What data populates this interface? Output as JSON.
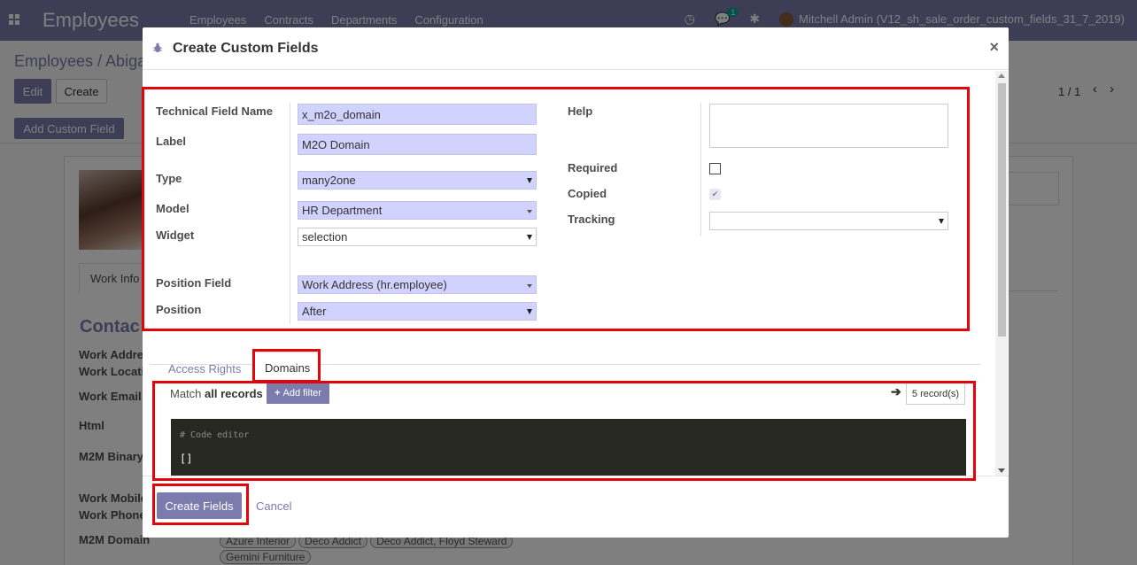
{
  "app": {
    "title": "Employees",
    "menu": [
      "Employees",
      "Contracts",
      "Departments",
      "Configuration"
    ],
    "chat_count": "1",
    "user": "Mitchell Admin (V12_sh_sale_order_custom_fields_31_7_2019)",
    "brand_color": "#7c7bad"
  },
  "background": {
    "breadcrumb": "Employees / Abiga",
    "edit_label": "Edit",
    "create_label": "Create",
    "pager": "1 / 1",
    "add_custom_field_label": "Add Custom Field",
    "work_info_tab": "Work Info",
    "contact_heading": "Contac",
    "field_labels": [
      "Work Addre",
      "Work Locati",
      "Work Email",
      "Html",
      "M2M Binary",
      "Work Mobile",
      "Work Phone",
      "M2M Domain"
    ],
    "tags": [
      "Azure Interior",
      "Deco Addict",
      "Deco Addict, Floyd Steward",
      "Gemini Furniture"
    ]
  },
  "modal": {
    "title": "Create Custom Fields",
    "close_glyph": "×",
    "form": {
      "technical_field_name_label": "Technical Field Name",
      "technical_field_name_value": "x_m2o_domain",
      "label_label": "Label",
      "label_value": "M2O Domain",
      "type_label": "Type",
      "type_value": "many2one",
      "model_label": "Model",
      "model_value": "HR Department",
      "widget_label": "Widget",
      "widget_value": "selection",
      "position_field_label": "Position Field",
      "position_field_value": "Work Address (hr.employee)",
      "position_label": "Position",
      "position_value": "After",
      "help_label": "Help",
      "required_label": "Required",
      "required_checked": false,
      "copied_label": "Copied",
      "copied_checked": true,
      "tracking_label": "Tracking",
      "tracking_value": ""
    },
    "tabs": [
      {
        "label": "Access Rights",
        "active": false
      },
      {
        "label": "Domains",
        "active": true
      }
    ],
    "domain": {
      "match_prefix": "Match",
      "match_scope": "all records",
      "add_filter_label": "Add filter",
      "records_label": "5 record(s)",
      "editor_comment": "# Code editor",
      "editor_code": "[]"
    },
    "footer": {
      "create_label": "Create Fields",
      "cancel_label": "Cancel"
    },
    "highlight_color": "#e2050a"
  }
}
